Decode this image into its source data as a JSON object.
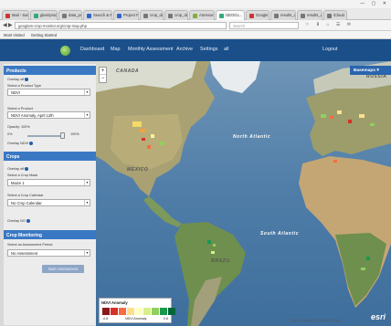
{
  "browser": {
    "tabs": [
      {
        "label": "Mail - Sam Lee ...",
        "color": "#c33"
      },
      {
        "label": "glam/product...",
        "color": "#3a7"
      },
      {
        "label": "data_portal",
        "color": "#777"
      },
      {
        "label": "Search & Filter...",
        "color": "#36c"
      },
      {
        "label": "Project Pr...",
        "color": "#36c"
      },
      {
        "label": "crop_data...",
        "color": "#777"
      },
      {
        "label": "crop_data...",
        "color": "#777"
      },
      {
        "label": "Annexure",
        "color": "#8a4"
      },
      {
        "label": "GEOGL...",
        "color": "#3a7"
      },
      {
        "label": "Google",
        "color": "#c33"
      },
      {
        "label": "results_data...",
        "color": "#777"
      },
      {
        "label": "results_data...",
        "color": "#777"
      },
      {
        "label": "iCloud",
        "color": "#777"
      }
    ],
    "url": "geoglam-crop-monitor.org/crop-map.php",
    "search_placeholder": "Search",
    "bookmarks": [
      "Most Visited",
      "Getting Started"
    ]
  },
  "navbar": {
    "items": [
      "Dashboard",
      "Map",
      "Monthly Assessment",
      "Archive",
      "Settings",
      "all"
    ],
    "logout": "Logout"
  },
  "sidebar": {
    "products": {
      "title": "Products",
      "overlay_label": "Overlay off",
      "product_type_label": "Select a Product Type",
      "product_type_value": "NDVI",
      "product_label": "Select a Product",
      "product_value": "NDVI Anomaly, April 12th",
      "opacity_label": "Opacity: 100%",
      "opacity_min": "0%",
      "opacity_max": "100%",
      "opacity_value": 1.0,
      "overlay2_label": "Overlay NDVI"
    },
    "crops": {
      "title": "Crops",
      "overlay_label": "Overlay off",
      "crop_mask_label": "Select a Crop Mask",
      "crop_mask_value": "Maize 1",
      "calendar_label": "Select a Crop Calendar",
      "calendar_value": "No Crop Calendar",
      "overlay2_label": "Overlay NO"
    },
    "monitoring": {
      "title": "Crop Monitoring",
      "period_label": "Select an Assessment Period",
      "period_value": "No Assessment",
      "button_label": "Start Assessment"
    }
  },
  "map": {
    "basemaps_label": "Basemaps",
    "labels": {
      "canada": "CANADA",
      "north_atlantic": "North Atlantic",
      "mexico": "MEXICO",
      "brazil": "BRAZIL",
      "south_atlantic": "South Atlantic",
      "russia": "RUSSIA"
    },
    "legend": {
      "title": "NDVI Anomaly",
      "colors": [
        "#8b1a1a",
        "#d73027",
        "#f46d43",
        "#fee08b",
        "#ffffbf",
        "#d9ef8b",
        "#91cf60",
        "#1a9850",
        "#006837"
      ],
      "min_label": "-0.6",
      "mid_label": "NDVI Anomaly",
      "max_label": "0.6"
    },
    "attribution": "Esri, DeLorme, FAO, USGS, NOAA, ...",
    "esri": "esri"
  }
}
